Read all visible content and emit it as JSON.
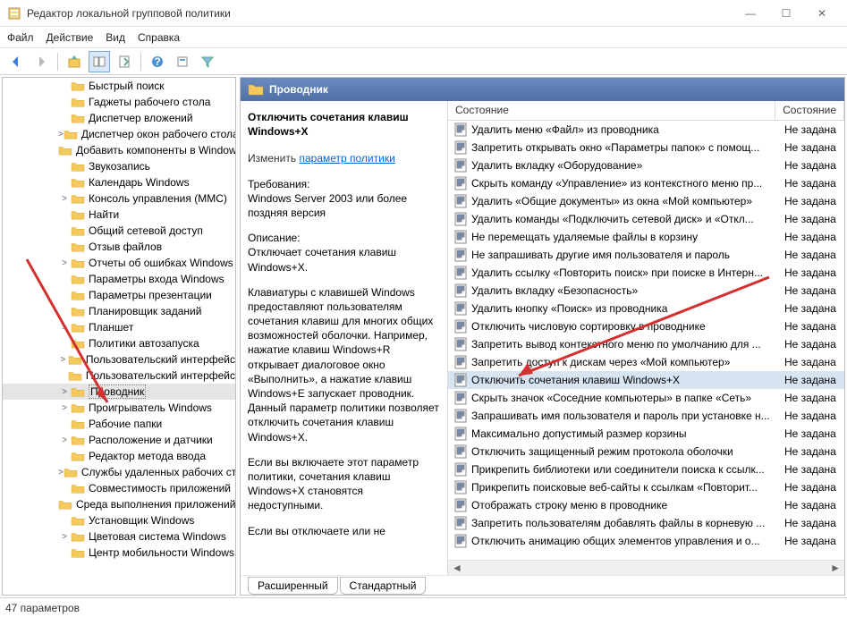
{
  "window": {
    "title": "Редактор локальной групповой политики"
  },
  "menu": {
    "file": "Файл",
    "action": "Действие",
    "view": "Вид",
    "help": "Справка"
  },
  "tree": {
    "items": [
      {
        "label": "Быстрый поиск",
        "expander": ""
      },
      {
        "label": "Гаджеты рабочего стола",
        "expander": ""
      },
      {
        "label": "Диспетчер вложений",
        "expander": ""
      },
      {
        "label": "Диспетчер окон рабочего стола",
        "expander": ">"
      },
      {
        "label": "Добавить компоненты в Windows",
        "expander": ""
      },
      {
        "label": "Звукозапись",
        "expander": ""
      },
      {
        "label": "Календарь Windows",
        "expander": ""
      },
      {
        "label": "Консоль управления (MMC)",
        "expander": ">"
      },
      {
        "label": "Найти",
        "expander": ""
      },
      {
        "label": "Общий сетевой доступ",
        "expander": ""
      },
      {
        "label": "Отзыв файлов",
        "expander": ""
      },
      {
        "label": "Отчеты об ошибках Windows",
        "expander": ">"
      },
      {
        "label": "Параметры входа Windows",
        "expander": ""
      },
      {
        "label": "Параметры презентации",
        "expander": ""
      },
      {
        "label": "Планировщик заданий",
        "expander": ""
      },
      {
        "label": "Планшет",
        "expander": ">"
      },
      {
        "label": "Политики автозапуска",
        "expander": ""
      },
      {
        "label": "Пользовательский интерфейс",
        "expander": ">"
      },
      {
        "label": "Пользовательский интерфейс",
        "expander": ""
      },
      {
        "label": "Проводник",
        "expander": ">",
        "selected": true
      },
      {
        "label": "Проигрыватель Windows",
        "expander": ">"
      },
      {
        "label": "Рабочие папки",
        "expander": ""
      },
      {
        "label": "Расположение и датчики",
        "expander": ">"
      },
      {
        "label": "Редактор метода ввода",
        "expander": ""
      },
      {
        "label": "Службы удаленных рабочих столов",
        "expander": ">"
      },
      {
        "label": "Совместимость приложений",
        "expander": ""
      },
      {
        "label": "Среда выполнения приложений",
        "expander": ""
      },
      {
        "label": "Установщик Windows",
        "expander": ""
      },
      {
        "label": "Цветовая система Windows",
        "expander": ">"
      },
      {
        "label": "Центр мобильности Windows",
        "expander": ""
      }
    ]
  },
  "header": {
    "title": "Проводник"
  },
  "desc": {
    "heading": "Отключить сочетания клавиш Windows+X",
    "edit_prefix": "Изменить ",
    "edit_link": "параметр политики",
    "req_label": "Требования:",
    "req_text": "Windows Server 2003 или более поздняя версия",
    "desc_label": "Описание:",
    "desc_text": "Отключает сочетания клавиш Windows+X.",
    "body1": "Клавиатуры с клавишей Windows предоставляют пользователям сочетания клавиш для многих общих возможностей оболочки. Например, нажатие клавиш Windows+R открывает диалоговое окно «Выполнить», а нажатие клавиш Windows+E запускает проводник. Данный параметр политики позволяет отключить сочетания клавиш Windows+X.",
    "body2": "Если вы включаете этот параметр политики, сочетания клавиш Windows+X становятся недоступными.",
    "body3": "Если вы отключаете или не"
  },
  "list": {
    "col1": "Состояние",
    "col2": "Состояние",
    "rows": [
      {
        "label": "Удалить меню «Файл» из проводника",
        "state": "Не задана"
      },
      {
        "label": "Запретить открывать окно «Параметры папок» с помощ...",
        "state": "Не задана"
      },
      {
        "label": "Удалить вкладку «Оборудование»",
        "state": "Не задана"
      },
      {
        "label": "Скрыть команду «Управление» из контекстного меню пр...",
        "state": "Не задана"
      },
      {
        "label": "Удалить «Общие документы» из окна «Мой компьютер»",
        "state": "Не задана"
      },
      {
        "label": "Удалить команды «Подключить сетевой диск» и «Откл...",
        "state": "Не задана"
      },
      {
        "label": "Не перемещать удаляемые файлы в корзину",
        "state": "Не задана"
      },
      {
        "label": "Не запрашивать другие имя пользователя и пароль",
        "state": "Не задана"
      },
      {
        "label": "Удалить ссылку «Повторить поиск» при поиске в Интерн...",
        "state": "Не задана"
      },
      {
        "label": "Удалить вкладку «Безопасность»",
        "state": "Не задана"
      },
      {
        "label": "Удалить кнопку «Поиск» из проводника",
        "state": "Не задана"
      },
      {
        "label": "Отключить числовую сортировку в проводнике",
        "state": "Не задана"
      },
      {
        "label": "Запретить вывод контекстного меню по умолчанию для ...",
        "state": "Не задана"
      },
      {
        "label": "Запретить доступ к дискам через «Мой компьютер»",
        "state": "Не задана"
      },
      {
        "label": "Отключить сочетания клавиш Windows+X",
        "state": "Не задана",
        "selected": true
      },
      {
        "label": "Скрыть значок «Соседние компьютеры» в папке «Сеть»",
        "state": "Не задана"
      },
      {
        "label": "Запрашивать имя пользователя и пароль при установке н...",
        "state": "Не задана"
      },
      {
        "label": "Максимально допустимый размер корзины",
        "state": "Не задана"
      },
      {
        "label": "Отключить защищенный режим протокола оболочки",
        "state": "Не задана"
      },
      {
        "label": "Прикрепить библиотеки или соединители поиска к ссылк...",
        "state": "Не задана"
      },
      {
        "label": "Прикрепить поисковые веб-сайты к ссылкам «Повторит...",
        "state": "Не задана"
      },
      {
        "label": "Отображать строку меню в проводнике",
        "state": "Не задана"
      },
      {
        "label": "Запретить пользователям добавлять файлы в корневую ...",
        "state": "Не задана"
      },
      {
        "label": "Отключить анимацию общих элементов управления и о...",
        "state": "Не задана"
      }
    ]
  },
  "tabs": {
    "ext": "Расширенный",
    "std": "Стандартный"
  },
  "status": {
    "text": "47 параметров"
  }
}
